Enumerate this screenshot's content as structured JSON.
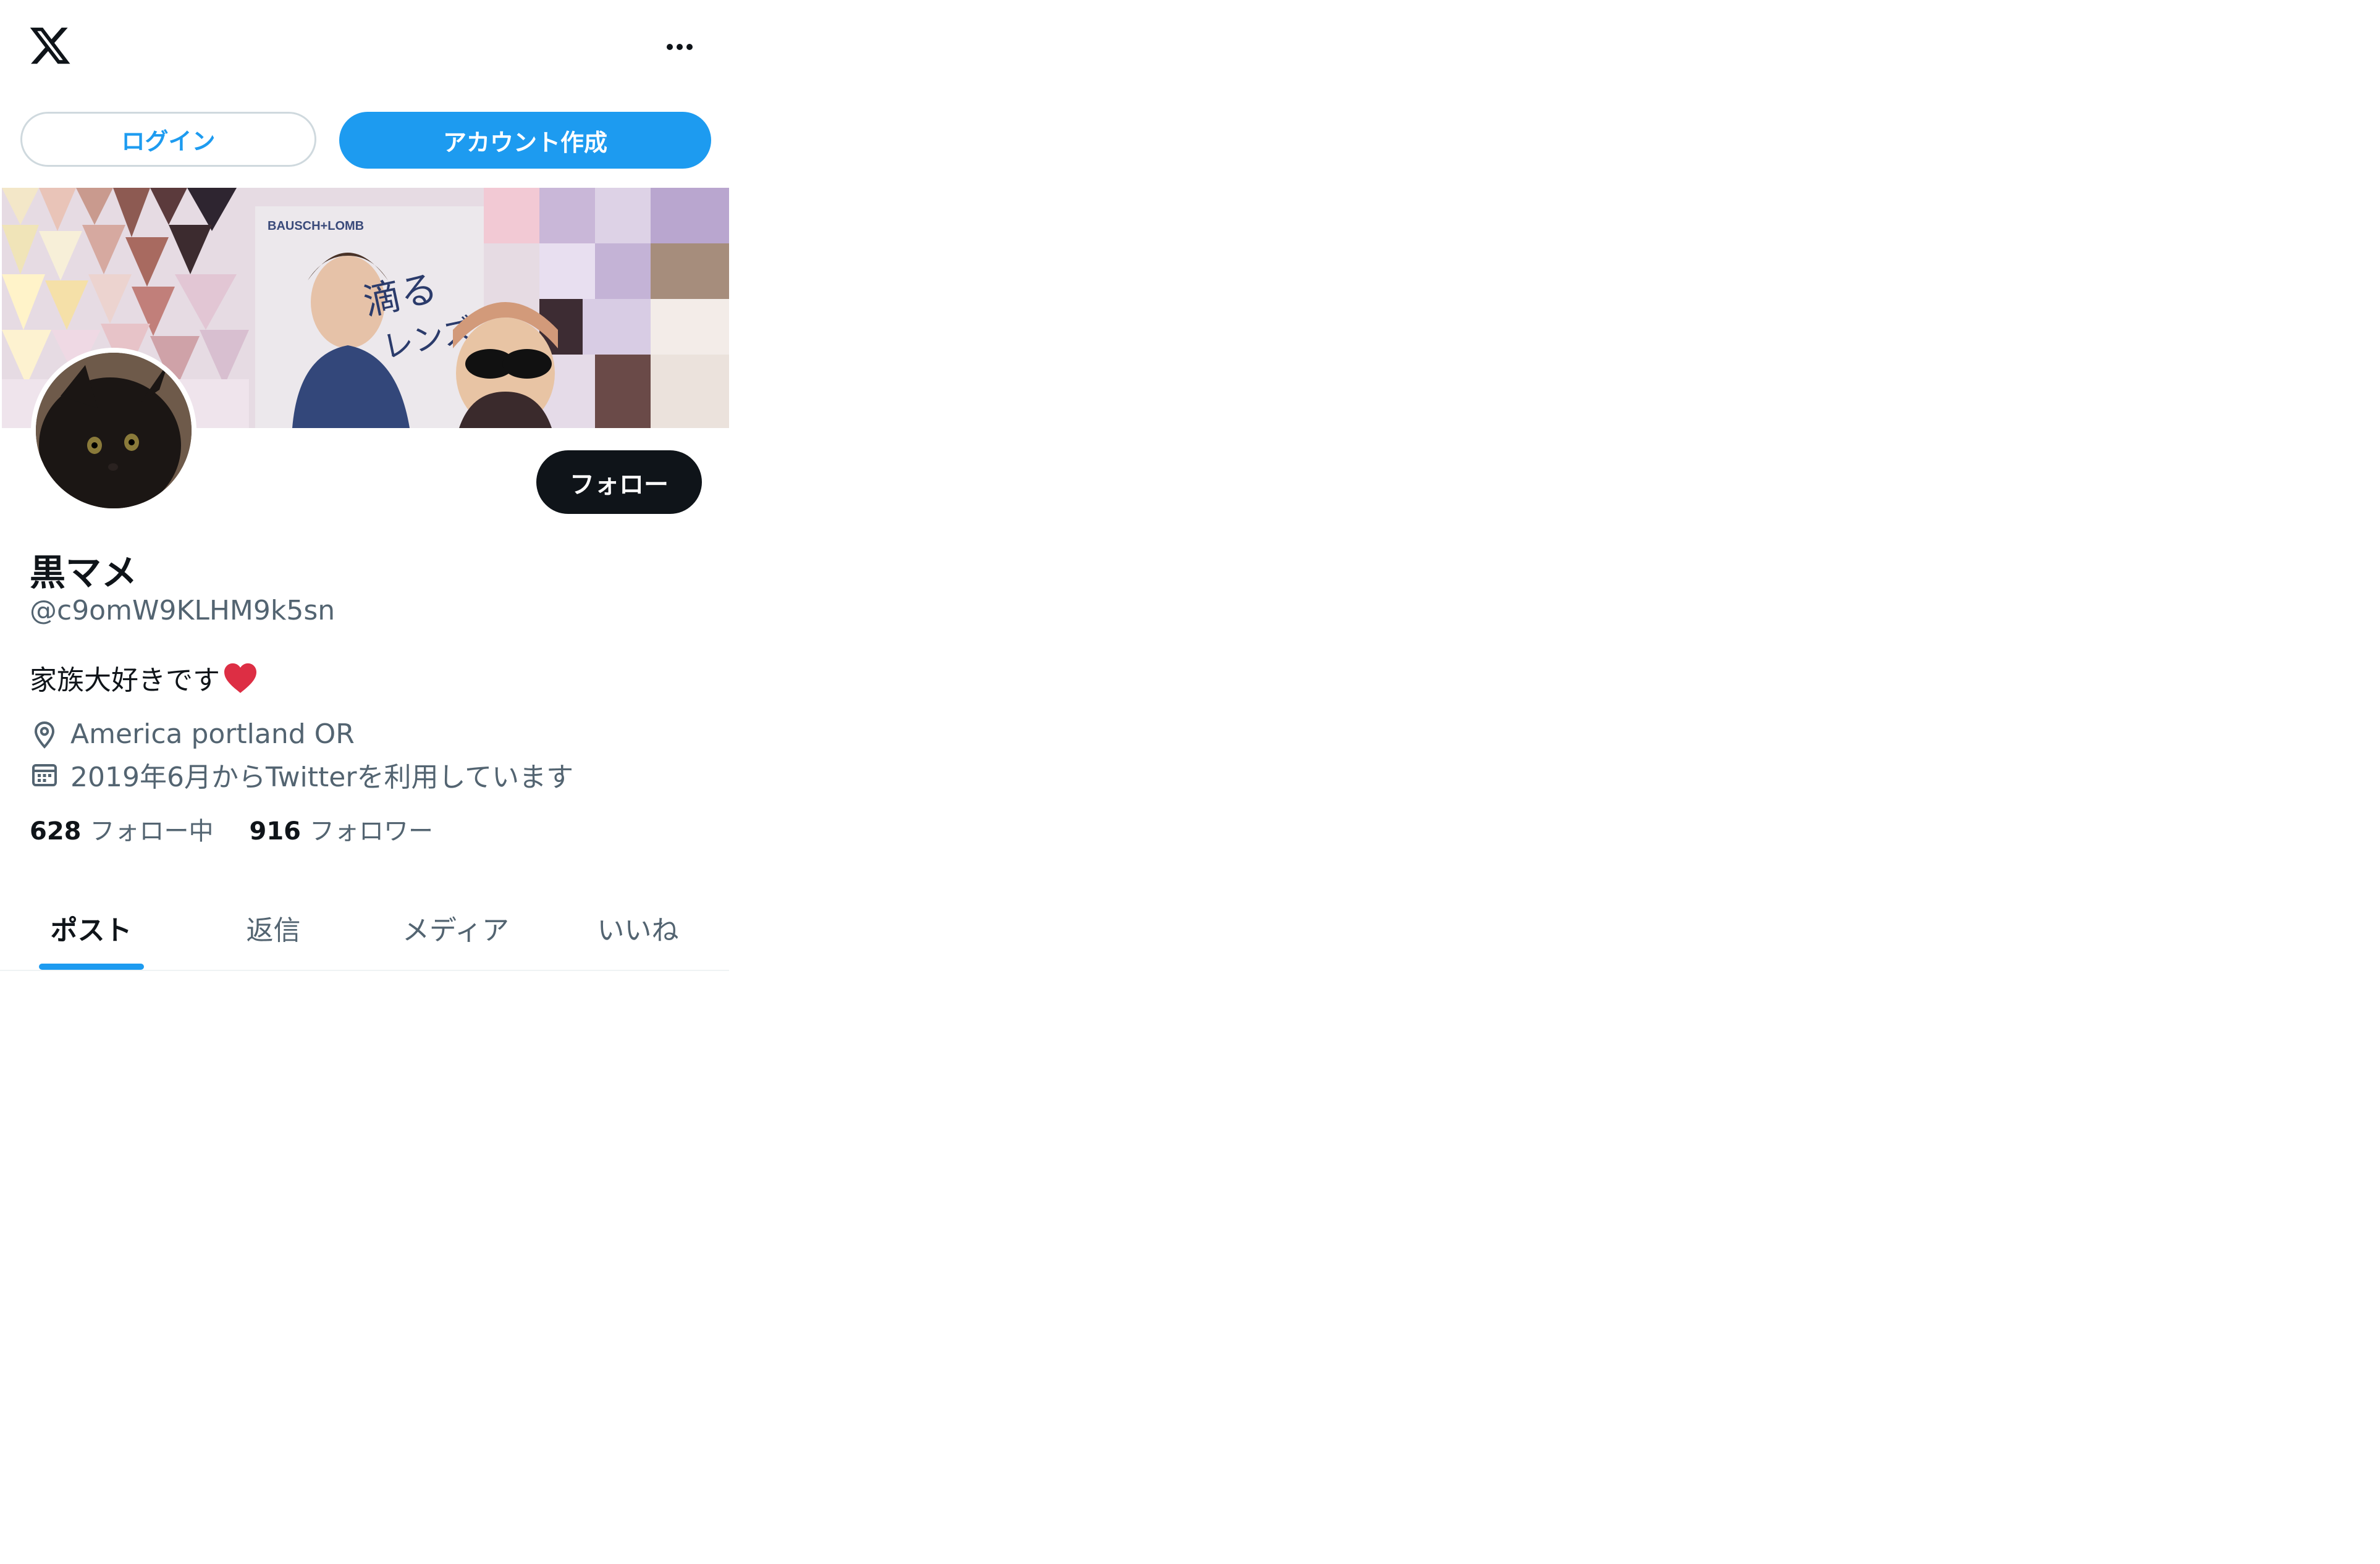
{
  "topbar": {
    "logo_icon": "x-logo-icon",
    "more_icon": "more-horizontal-icon"
  },
  "auth": {
    "login_label": "ログイン",
    "signup_label": "アカウント作成"
  },
  "profile": {
    "display_name": "黒マメ",
    "handle": "@c9omW9KLHM9k5sn",
    "bio_text": "家族大好きです",
    "bio_emoji_icon": "red-heart-icon",
    "location": "America portland OR",
    "location_icon": "location-pin-icon",
    "joined": "2019年6月からTwitterを利用しています",
    "joined_icon": "calendar-icon",
    "follow_label": "フォロー",
    "stats": {
      "following_count": "628",
      "following_label": "フォロー中",
      "followers_count": "916",
      "followers_label": "フォロワー"
    }
  },
  "tabs": [
    {
      "label": "ポスト",
      "active": true
    },
    {
      "label": "返信",
      "active": false
    },
    {
      "label": "メディア",
      "active": false
    },
    {
      "label": "いいね",
      "active": false
    }
  ],
  "colors": {
    "accent": "#1d9bf0",
    "text_primary": "#0f1419",
    "text_secondary": "#536471",
    "heart": "#e0245e"
  }
}
